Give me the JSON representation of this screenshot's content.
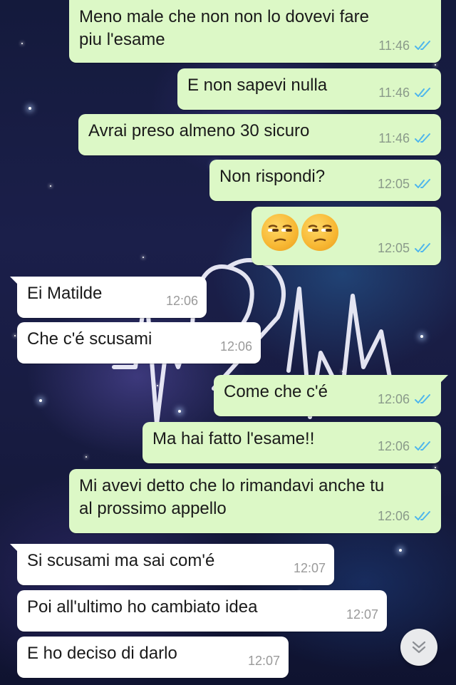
{
  "chat": {
    "messages": [
      {
        "direction": "out",
        "text": "Meno male che non non lo dovevi fare\npiu l'esame",
        "time": "11:46",
        "status": "read"
      },
      {
        "direction": "out",
        "text": "E non sapevi nulla",
        "time": "11:46",
        "status": "read"
      },
      {
        "direction": "out",
        "text": "Avrai preso almeno 30 sicuro",
        "time": "11:46",
        "status": "read"
      },
      {
        "direction": "out",
        "text": "Non rispondi?",
        "time": "12:05",
        "status": "read"
      },
      {
        "direction": "out",
        "emoji": [
          "unamused-face",
          "unamused-face"
        ],
        "time": "12:05",
        "status": "read"
      },
      {
        "direction": "in",
        "text": "Ei Matilde",
        "time": "12:06"
      },
      {
        "direction": "in",
        "text": "Che c'é scusami",
        "time": "12:06"
      },
      {
        "direction": "out",
        "text": "Come che c'é",
        "time": "12:06",
        "status": "read"
      },
      {
        "direction": "out",
        "text": "Ma hai fatto l'esame!!",
        "time": "12:06",
        "status": "read"
      },
      {
        "direction": "out",
        "text": "Mi avevi detto che lo rimandavi anche tu\nal prossimo appello",
        "time": "12:06",
        "status": "read"
      },
      {
        "direction": "in",
        "text": "Si scusami ma sai com'é",
        "time": "12:07"
      },
      {
        "direction": "in",
        "text": "Poi all'ultimo ho cambiato idea",
        "time": "12:07"
      },
      {
        "direction": "in",
        "text": "E ho deciso di darlo",
        "time": "12:07"
      }
    ]
  },
  "scroll_button": {
    "icon": "double-chevron-down-icon"
  },
  "colors": {
    "outgoing_bubble": "#dcf8c6",
    "incoming_bubble": "#ffffff",
    "read_ticks": "#4fb6ec",
    "timestamp": "#8a9a8a"
  }
}
